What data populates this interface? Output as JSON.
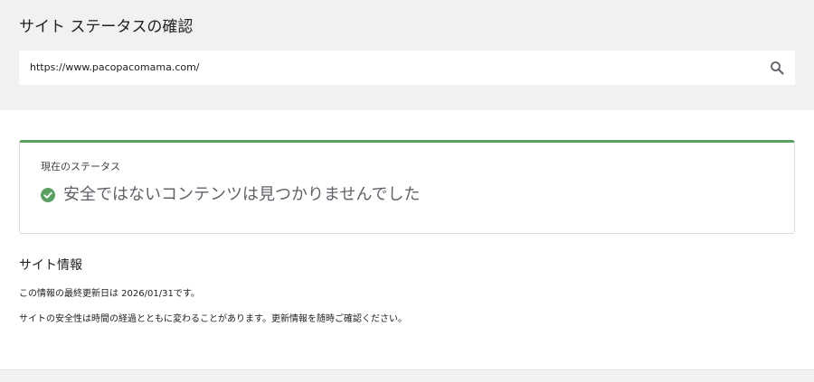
{
  "header": {
    "title": "サイト ステータスの確認"
  },
  "search": {
    "value": "https://www.pacopacomama.com/",
    "icon": "search-icon"
  },
  "status": {
    "label": "現在のステータス",
    "message": "安全ではないコンテンツは見つかりませんでした",
    "icon": "check-circle-icon",
    "accent_color": "#5b9f62"
  },
  "site_info": {
    "heading": "サイト情報",
    "last_updated": "この情報の最終更新日は 2026/01/31です。",
    "note": "サイトの安全性は時間の経過とともに変わることがあります。更新情報を随時ご確認ください。"
  }
}
